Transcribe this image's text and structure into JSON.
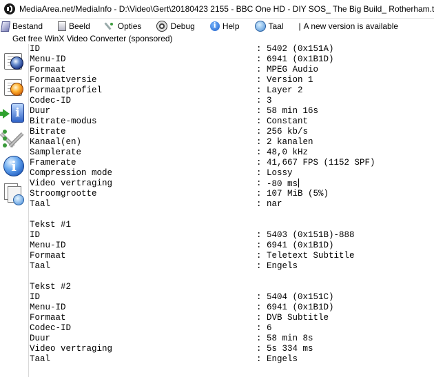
{
  "window": {
    "title": "MediaArea.net/MediaInfo - D:\\Video\\Gert\\20180423 2155 - BBC One HD - DIY SOS_ The Big Build_ Rotherham.ts"
  },
  "menu": {
    "file": "Bestand",
    "view": "Beeld",
    "options": "Opties",
    "debug": "Debug",
    "help": "Help",
    "language": "Taal",
    "separator": "|",
    "new_version": "A new version is available"
  },
  "promo": "Get free WinX Video Converter (sponsored)",
  "sidebar": {
    "icons": [
      "open-file-icon",
      "open-folder-icon",
      "export-icon",
      "preferences-icon",
      "about-icon",
      "multiple-files-icon"
    ]
  },
  "audio": [
    {
      "key": "ID",
      "sep": ":",
      "value": "5402 (0x151A)"
    },
    {
      "key": "Menu-ID",
      "sep": ":",
      "value": "6941 (0x1B1D)"
    },
    {
      "key": "Formaat",
      "sep": ":",
      "value": "MPEG Audio"
    },
    {
      "key": "Formaatversie",
      "sep": ":",
      "value": "Version 1"
    },
    {
      "key": "Formaatprofiel",
      "sep": ":",
      "value": "Layer 2"
    },
    {
      "key": "Codec-ID",
      "sep": ":",
      "value": "3"
    },
    {
      "key": "Duur",
      "sep": ":",
      "value": "58 min 16s"
    },
    {
      "key": "Bitrate-modus",
      "sep": ":",
      "value": "Constant"
    },
    {
      "key": "Bitrate",
      "sep": ":",
      "value": "256 kb/s"
    },
    {
      "key": "Kanaal(en)",
      "sep": ":",
      "value": "2 kanalen"
    },
    {
      "key": "Samplerate",
      "sep": ":",
      "value": "48,0 kHz"
    },
    {
      "key": "Framerate",
      "sep": ":",
      "value": "41,667 FPS (1152 SPF)"
    },
    {
      "key": "Compression mode",
      "sep": ":",
      "value": "Lossy"
    },
    {
      "key": "Video vertraging",
      "sep": ":",
      "value": "-80 ms"
    },
    {
      "key": "Stroomgrootte",
      "sep": ":",
      "value": "107 MiB (5%)"
    },
    {
      "key": "Taal",
      "sep": ":",
      "value": "nar"
    }
  ],
  "text1": {
    "heading": "Tekst #1",
    "rows": [
      {
        "key": "ID",
        "sep": ":",
        "value": "5403 (0x151B)-888"
      },
      {
        "key": "Menu-ID",
        "sep": ":",
        "value": "6941 (0x1B1D)"
      },
      {
        "key": "Formaat",
        "sep": ":",
        "value": "Teletext Subtitle"
      },
      {
        "key": "Taal",
        "sep": ":",
        "value": "Engels"
      }
    ]
  },
  "text2": {
    "heading": "Tekst #2",
    "rows": [
      {
        "key": "ID",
        "sep": ":",
        "value": "5404 (0x151C)"
      },
      {
        "key": "Menu-ID",
        "sep": ":",
        "value": "6941 (0x1B1D)"
      },
      {
        "key": "Formaat",
        "sep": ":",
        "value": "DVB Subtitle"
      },
      {
        "key": "Codec-ID",
        "sep": ":",
        "value": "6"
      },
      {
        "key": "Duur",
        "sep": ":",
        "value": "58 min 8s"
      },
      {
        "key": "Video vertraging",
        "sep": ":",
        "value": "5s 334 ms"
      },
      {
        "key": "Taal",
        "sep": ":",
        "value": "Engels"
      }
    ]
  }
}
